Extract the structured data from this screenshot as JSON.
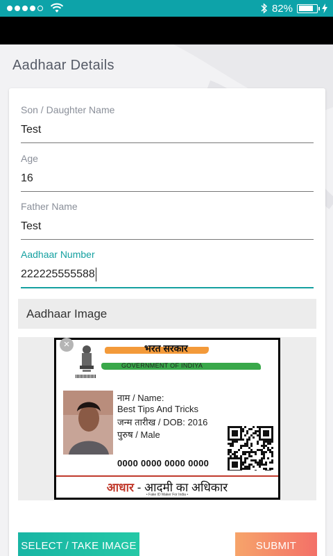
{
  "status_bar": {
    "signal_filled": 4,
    "signal_total": 5,
    "battery_percent": "82%",
    "battery_level": 0.82
  },
  "page": {
    "title": "Aadhaar Details"
  },
  "form": {
    "fields": [
      {
        "label": "Son / Daughter Name",
        "value": "Test"
      },
      {
        "label": "Age",
        "value": "16"
      },
      {
        "label": "Father Name",
        "value": "Test"
      },
      {
        "label": "Aadhaar Number",
        "value": "222225555588"
      }
    ],
    "image_section_label": "Aadhaar Image"
  },
  "aadhaar_card": {
    "bharat_sarkar": "भरत सरकार",
    "government": "GOVERNMENT OF INDIYA",
    "name_label": "नाम / Name:",
    "name_value": "Best Tips And Tricks",
    "dob_line": "जन्म तारीख  / DOB: 2016",
    "gender_line": "पुरुष  / Male",
    "number": "0000 0000 0000 0000",
    "footer_red": "आधार",
    "footer_rest": " - आदमी का अधिकार",
    "fake_note": "• Fake ID Maker For India •"
  },
  "buttons": {
    "select": "SELECT / TAKE IMAGE",
    "submit": "SUBMIT"
  },
  "colors": {
    "accent": "#14a0a0",
    "status_bar": "#0da3a9",
    "submit_gradient": [
      "#f6a46a",
      "#f37068"
    ]
  }
}
